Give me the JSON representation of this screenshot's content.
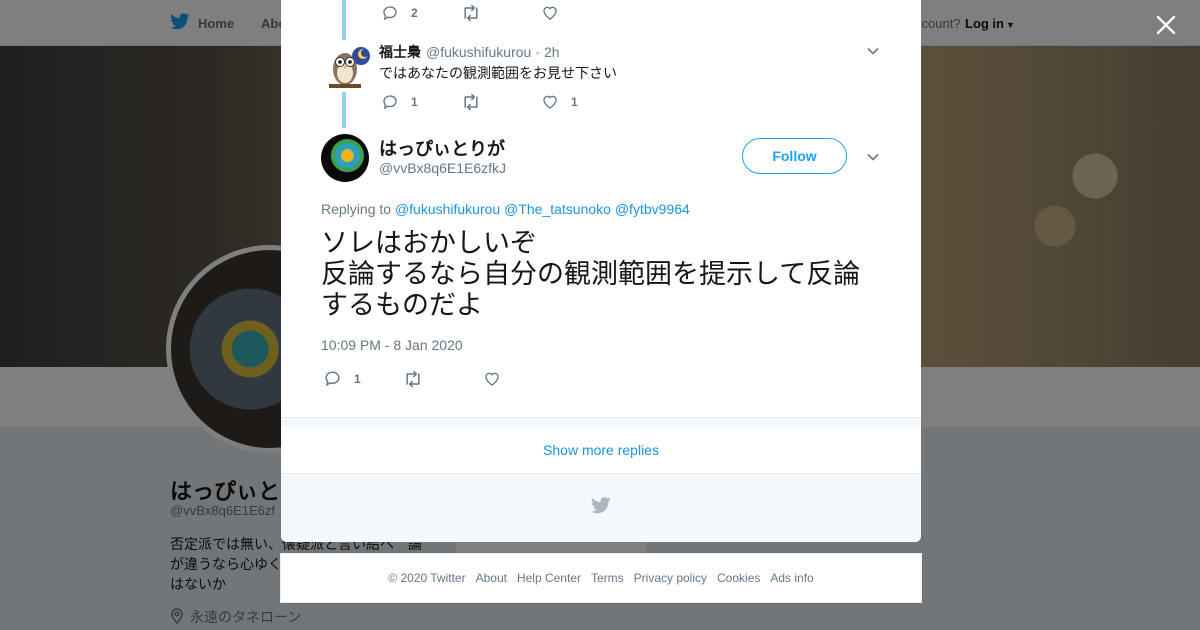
{
  "nav": {
    "home_label": "Home",
    "about_label": "Abo",
    "account_prompt": "ccount?",
    "login_label": "Log in"
  },
  "profile_bg": {
    "name": "はっぴぃと",
    "handle": "@vvBx8q6E1E6zf",
    "bio_lines": [
      "否定派では無い、懐疑派と言い給へ　論",
      "が違うなら心ゆく",
      "はないか"
    ],
    "location": "永遠のタネローン"
  },
  "thread": {
    "prev_reply_count": "2",
    "reply": {
      "author": "福士梟",
      "handle": "@fukushifukurou",
      "separator": "·",
      "time": "2h",
      "text": "ではあなたの観測範囲をお見せ下さい",
      "reply_count": "1",
      "like_count": "1"
    }
  },
  "main_tweet": {
    "author": "はっぴぃとりが",
    "handle": "@vvBx8q6E1E6zfkJ",
    "follow_label": "Follow",
    "replying_prefix": "Replying to",
    "replying_to": [
      "@fukushifukurou",
      "@The_tatsunoko",
      "@fytbv9964"
    ],
    "text_lines": [
      "ソレはおかしいぞ",
      "反論するなら自分の観測範囲を提示して反論",
      "するものだよ"
    ],
    "timestamp": "10:09 PM - 8 Jan 2020",
    "reply_count": "1"
  },
  "show_more_label": "Show more replies",
  "footer": {
    "links": [
      "© 2020 Twitter",
      "About",
      "Help Center",
      "Terms",
      "Privacy policy",
      "Cookies",
      "Ads info"
    ]
  },
  "colors": {
    "brand": "#1da1f2",
    "link": "#1b95e0",
    "thread_line": "#8ed0f9",
    "muted": "#657786"
  }
}
